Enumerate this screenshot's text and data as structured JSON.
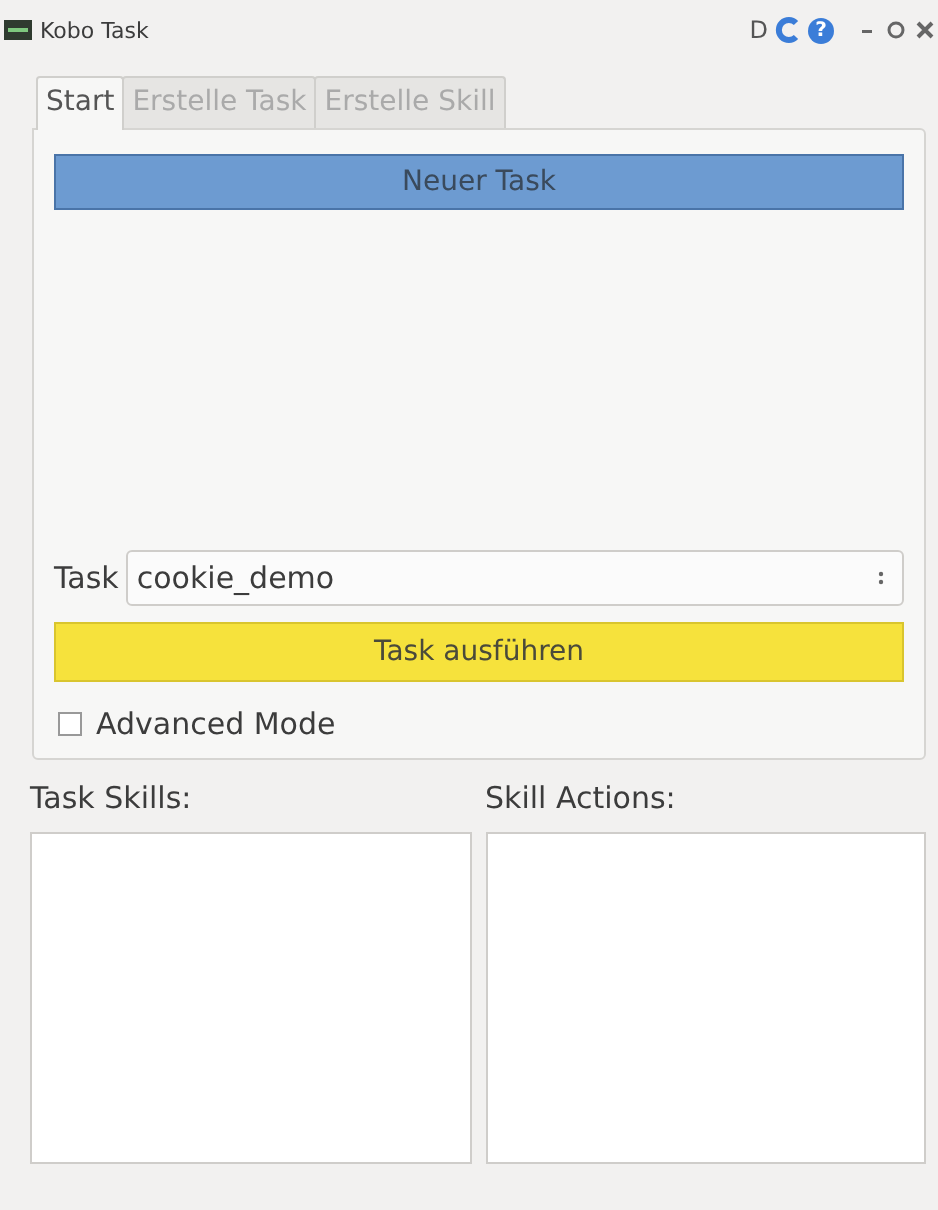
{
  "window": {
    "title": "Kobo Task",
    "tool_letter": "D",
    "help_glyph": "?"
  },
  "tabs": [
    {
      "label": "Start",
      "selected": true
    },
    {
      "label": "Erstelle Task",
      "selected": false
    },
    {
      "label": "Erstelle Skill",
      "selected": false
    }
  ],
  "new_task_button": "Neuer Task",
  "task_select": {
    "label": "Task",
    "value": "cookie_demo"
  },
  "run_button": "Task ausführen",
  "advanced_mode": {
    "label": "Advanced Mode",
    "checked": false
  },
  "lists": [
    {
      "label": "Task Skills:"
    },
    {
      "label": "Skill Actions:"
    }
  ]
}
